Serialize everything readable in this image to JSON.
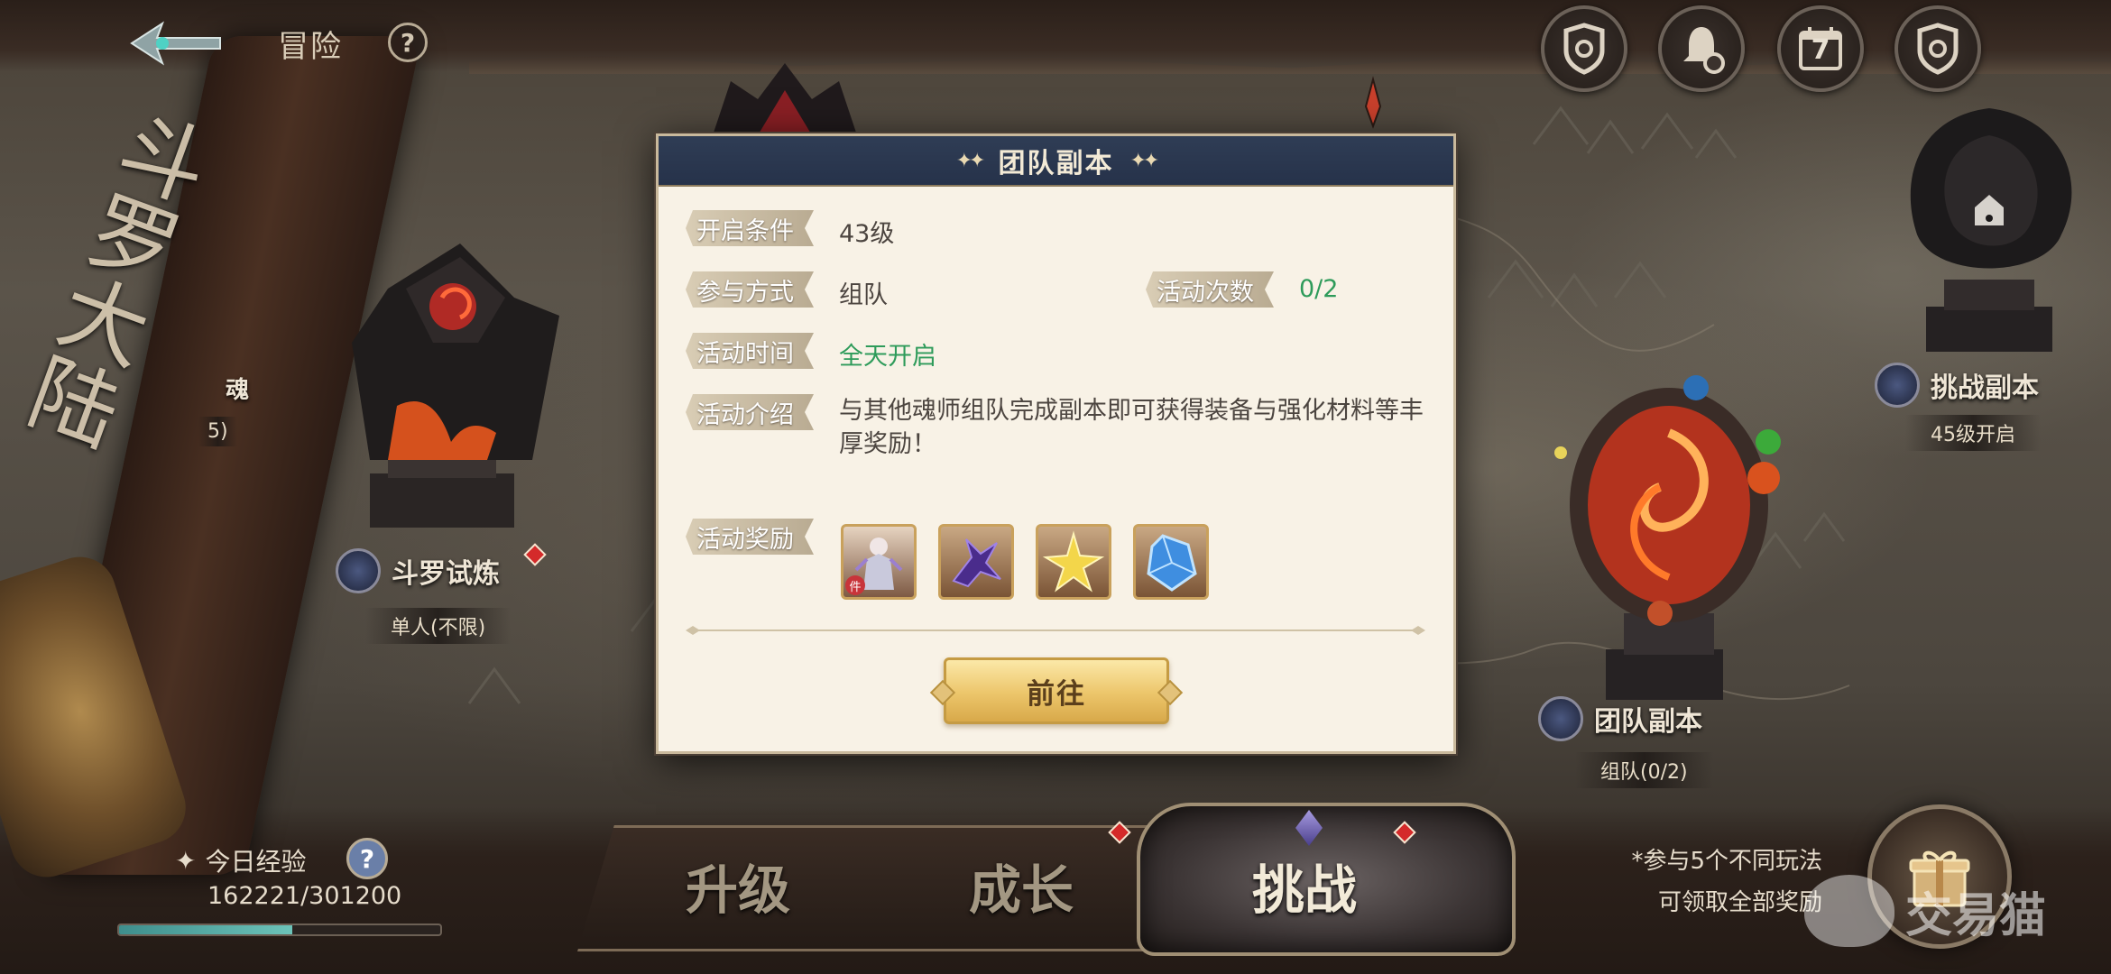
{
  "header": {
    "title": "冒险",
    "help": "?",
    "calendar_day": "7"
  },
  "scroll": {
    "title": "斗罗大陆"
  },
  "map": {
    "nodes": [
      {
        "name": "斗罗试炼",
        "sub": "单人(不限)"
      },
      {
        "name": "挑战副本",
        "sub": "45级开启"
      },
      {
        "name": "团队副本",
        "sub": "组队(0/2)"
      }
    ],
    "partial_left_label": "魂",
    "partial_left_sub": "5)"
  },
  "dialog": {
    "title": "团队副本",
    "rows": {
      "condition_label": "开启条件",
      "condition_value": "43级",
      "mode_label": "参与方式",
      "mode_value": "组队",
      "count_label": "活动次数",
      "count_value": "0/2",
      "time_label": "活动时间",
      "time_value": "全天开启",
      "intro_label": "活动介绍",
      "intro_value": "与其他魂师组队完成副本即可获得装备与强化材料等丰厚奖励！",
      "reward_label": "活动奖励"
    },
    "rewards": [
      {
        "icon": "character-armor-icon",
        "badge": "件"
      },
      {
        "icon": "purple-claw-icon"
      },
      {
        "icon": "gold-star-shard-icon"
      },
      {
        "icon": "blue-crystal-icon"
      }
    ],
    "go_label": "前往"
  },
  "bottom": {
    "exp_label": "今日经验",
    "exp_value": "162221/301200",
    "exp_progress": 0.54,
    "tabs": [
      "升级",
      "成长",
      "挑战"
    ],
    "active_tab": "挑战",
    "hint_line1": "*参与5个不同玩法",
    "hint_line2": "可领取全部奖励"
  },
  "watermark": "交易猫",
  "colors": {
    "dialog_header": "#2f3d55",
    "dialog_bg": "#f8f2e6",
    "green_value": "#2e9b5a",
    "gold_button": "#ecc56a"
  }
}
